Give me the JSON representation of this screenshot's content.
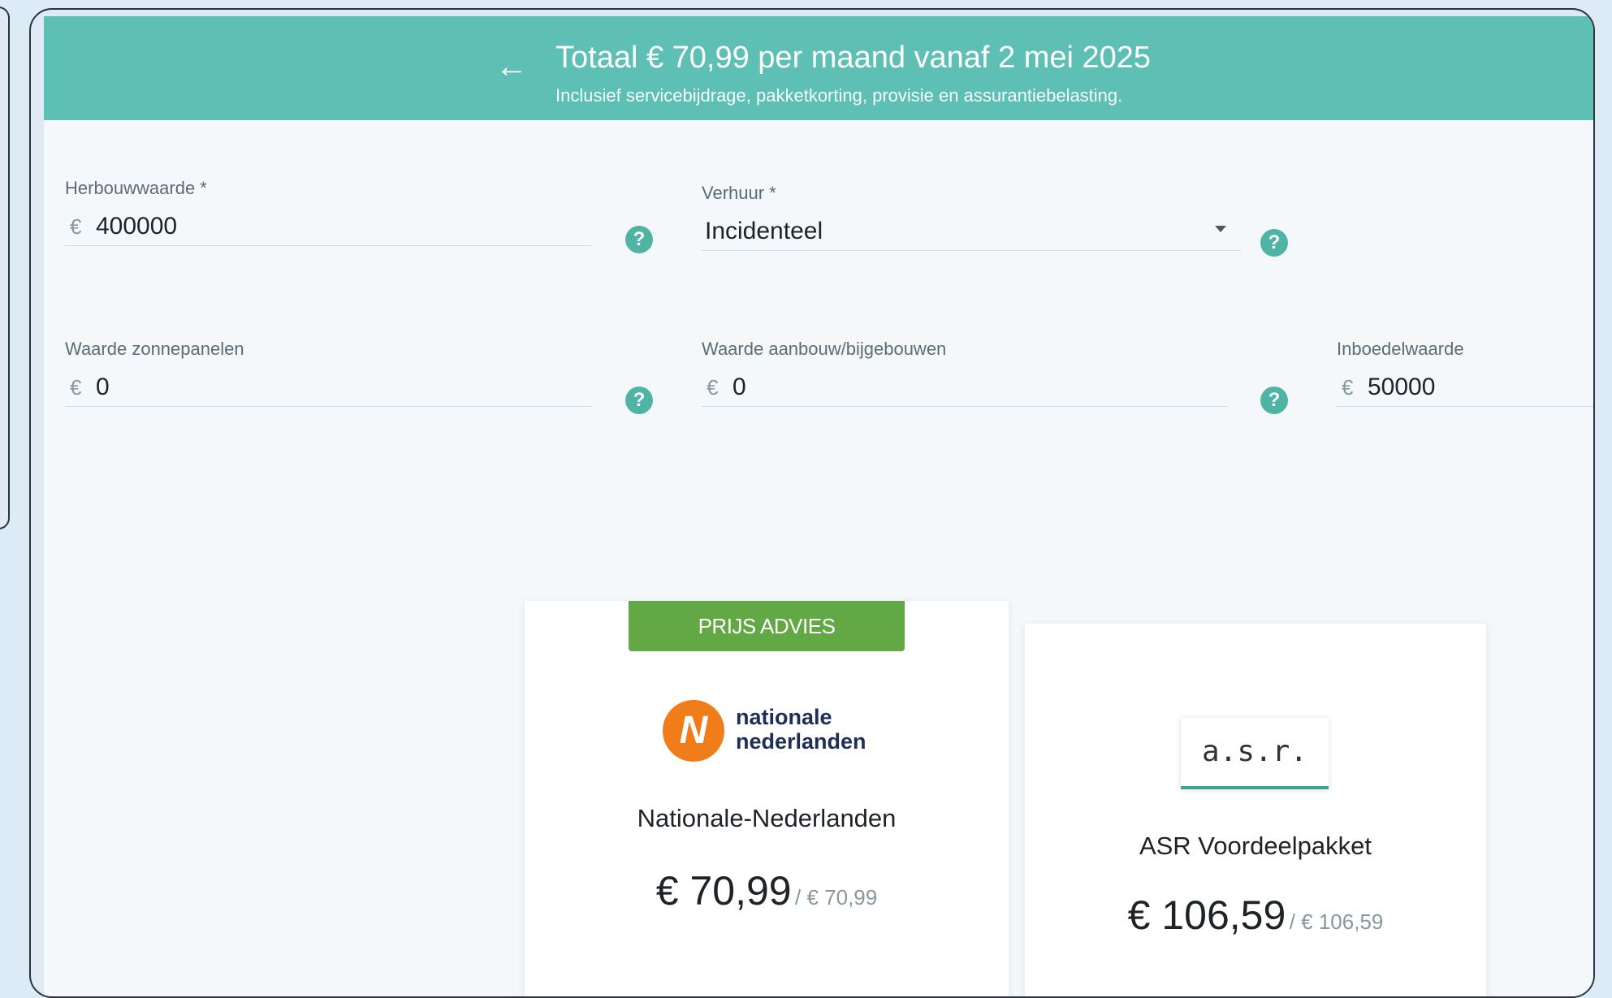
{
  "header": {
    "back_icon": "←",
    "title": "Totaal € 70,99 per maand vanaf 2 mei 2025",
    "subtitle": "Inclusief servicebijdrage, pakketkorting, provisie en assurantiebelasting."
  },
  "fields": {
    "herbouwwaarde": {
      "label": "Herbouwwaarde *",
      "currency": "€",
      "value": "400000"
    },
    "verhuur": {
      "label": "Verhuur *",
      "value": "Incidenteel"
    },
    "zonnepanelen": {
      "label": "Waarde zonnepanelen",
      "currency": "€",
      "value": "0"
    },
    "aanbouw": {
      "label": "Waarde aanbouw/bijgebouwen",
      "currency": "€",
      "value": "0"
    },
    "inboedel": {
      "label": "Inboedelwaarde",
      "currency": "€",
      "value": "50000"
    }
  },
  "help_icon": "?",
  "cards": [
    {
      "badge": "PRIJS ADVIES",
      "logo_letter": "N",
      "logo_line1": "nationale",
      "logo_line2": "nederlanden",
      "name": "Nationale-Nederlanden",
      "price": "€ 70,99",
      "price_sub": "/ € 70,99"
    },
    {
      "logo_text": "a.s.r.",
      "name": "ASR Voordeelpakket",
      "price": "€ 106,59",
      "price_sub": "/ € 106,59"
    }
  ],
  "colors": {
    "header_bg": "#5ebfb5",
    "badge_bg": "#62a845",
    "help_bg": "#4fb4a3",
    "nn_orange": "#f07c1a"
  }
}
